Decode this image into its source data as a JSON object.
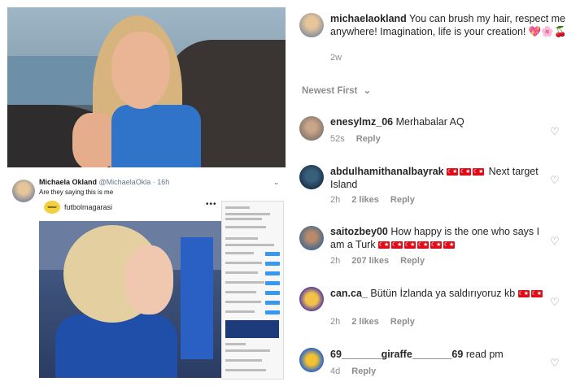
{
  "tweet": {
    "name": "Michaela Okland",
    "handle": "@MichaelaOkla · 16h",
    "text": "Are they saying this is me",
    "caret_icon": "chevron-down-icon"
  },
  "embedded_post": {
    "logo_text": "futbol",
    "username": "futbolmagarasi",
    "menu_icon": "more-dots-icon"
  },
  "caption": {
    "username": "michaelaokland",
    "text": "You can brush my hair, respect me anywhere! Imagination, life is your creation! 💖🌸🍒",
    "time": "2w"
  },
  "sort": {
    "label": "Newest First",
    "icon": "chevron-down-icon"
  },
  "comments": [
    {
      "username": "enesylmz_06",
      "text": "Merhabalar AQ",
      "time": "52s",
      "likes": "",
      "reply": "Reply"
    },
    {
      "username": "abdulhamithanalbayrak",
      "text": "Next target Island",
      "flags_before": 3,
      "time": "2h",
      "likes": "2 likes",
      "reply": "Reply"
    },
    {
      "username": "saitozbey00",
      "text": "How happy is the one who says I am a Turk",
      "flags_after": 6,
      "time": "2h",
      "likes": "207 likes",
      "reply": "Reply"
    },
    {
      "username": "can.ca_",
      "text": "Bütün İzlanda ya saldırıyoruz kb",
      "flags_after": 2,
      "time": "2h",
      "likes": "2 likes",
      "reply": "Reply"
    },
    {
      "username": "69_______giraffe_______69",
      "text": "read pm",
      "time": "4d",
      "likes": "",
      "reply": "Reply"
    }
  ],
  "colors": {
    "text": "#262626",
    "muted": "#8e8e8e",
    "turkish_flag": "#e30a17",
    "heart": "#8e8e8e"
  }
}
